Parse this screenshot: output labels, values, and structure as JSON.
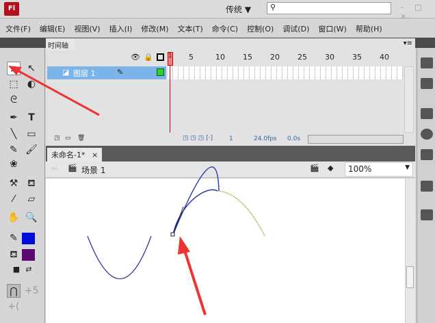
{
  "app": {
    "logo": "Fl",
    "workspace": "传统 ▼",
    "window_controls": "– □ ×"
  },
  "menu": [
    "文件(F)",
    "编辑(E)",
    "视图(V)",
    "插入(I)",
    "修改(M)",
    "文本(T)",
    "命令(C)",
    "控制(O)",
    "调试(D)",
    "窗口(W)",
    "帮助(H)"
  ],
  "timeline": {
    "tab": "时间轴",
    "layer": "图层 1",
    "frame_numbers": [
      "1",
      "5",
      "10",
      "15",
      "20",
      "25",
      "30",
      "35",
      "40"
    ],
    "current_frame": "1",
    "fps": "24.0fps",
    "time": "0.0s"
  },
  "document": {
    "tab": "未命名-1*",
    "close": "×",
    "scene": "场景 1",
    "zoom": "100%"
  },
  "toolbar": {
    "fill_color": "#000cd8",
    "stroke_color": "#5a0a70"
  }
}
